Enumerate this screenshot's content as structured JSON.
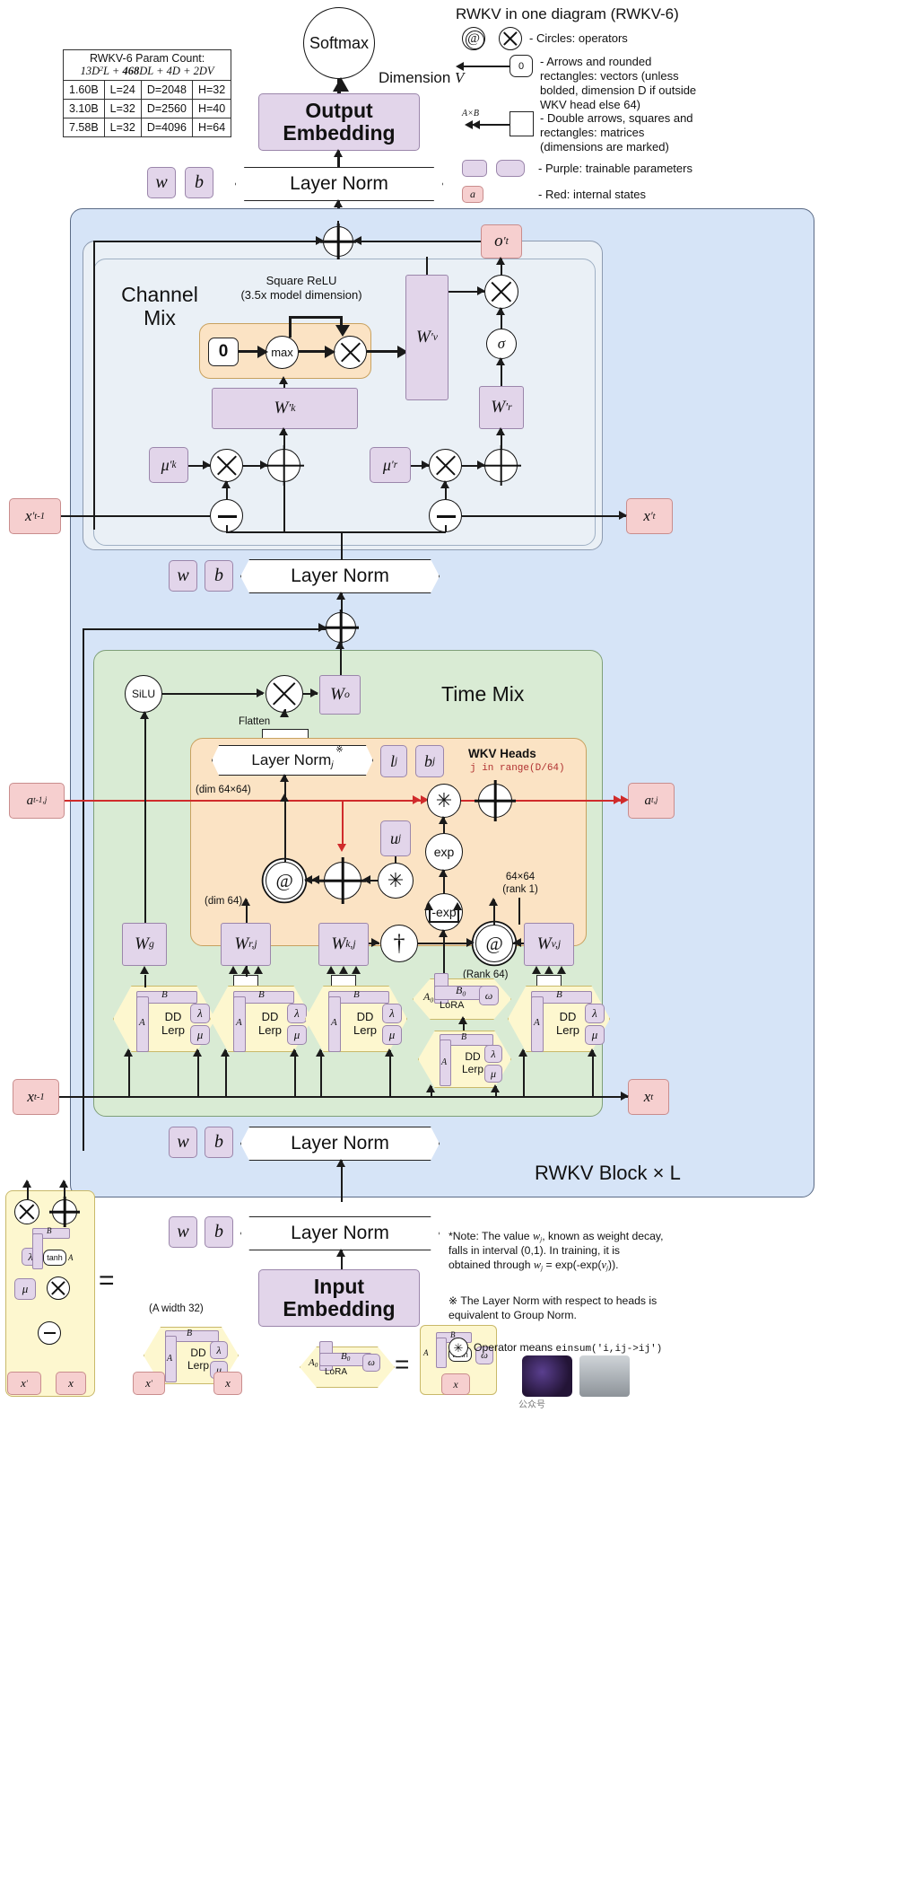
{
  "title": "RWKV in one diagram (RWKV-6)",
  "param_table": {
    "header_line1": "RWKV-6 Param Count:",
    "header_line2": "13D²L + 468DL + 4D + 2DV",
    "rows": [
      [
        "1.60B",
        "L=24",
        "D=2048",
        "H=32"
      ],
      [
        "3.10B",
        "L=32",
        "D=2560",
        "H=40"
      ],
      [
        "7.58B",
        "L=32",
        "D=4096",
        "H=64"
      ]
    ]
  },
  "legend": {
    "circles": "- Circles: operators",
    "zero_box": "0",
    "vectors": "- Arrows and rounded rectangles: vectors (unless bolded, dimension D if outside WKV head else 64)",
    "matrix_dim": "A×B",
    "matrices": "- Double arrows, squares and rectangles: matrices (dimensions are marked)",
    "purple": "- Purple: trainable parameters",
    "red_token": "a",
    "red": "- Red: internal states"
  },
  "top": {
    "softmax": "Softmax",
    "dimension": "Dimension V",
    "output_embedding": "Output Embedding",
    "layer_norm": "Layer Norm",
    "w": "w",
    "b": "b"
  },
  "channel_mix": {
    "title_line1": "Channel",
    "title_line2": "Mix",
    "square_relu_1": "Square ReLU",
    "square_relu_2": "(3.5x model dimension)",
    "zero": "0",
    "max": "max",
    "Wk": "W′k",
    "Wv": "W′v",
    "Wr": "W′r",
    "mu_k": "μ′k",
    "mu_r": "μ′r",
    "sigma": "σ",
    "x_prev": "x′t-1",
    "x_cur": "x′t",
    "o_cur": "o′t"
  },
  "time_mix": {
    "title": "Time Mix",
    "silu": "SiLU",
    "Wo": "Wo",
    "flatten": "Flatten",
    "layer_norm_j": "Layer Normj",
    "l_j": "lj",
    "b_j": "bj",
    "u_j": "uj",
    "wkv_heads": "WKV Heads",
    "wkv_range": "j in range(D/64)",
    "dim_64x64": "(dim 64×64)",
    "dim_64": "(dim 64)",
    "rank1_line1": "64×64",
    "rank1_line2": "(rank 1)",
    "rank64": "(Rank 64)",
    "exp": "exp",
    "negexp": "-exp",
    "Wg": "Wg",
    "Wrj": "Wr,j",
    "Wkj": "Wk,j",
    "Wvj": "Wv,j",
    "a_prev": "at-1,j",
    "a_cur": "at,j",
    "x_prev": "xt-1",
    "x_cur": "xt",
    "dd_lerp_1": "DD",
    "dd_lerp_2": "Lerp",
    "lora_A0": "A₀",
    "lora_B0": "B₀",
    "lora_label": "LoRA",
    "omega": "ω",
    "lam": "λ",
    "mu": "μ",
    "A": "A",
    "B": "B"
  },
  "bottom": {
    "block_label": "RWKV Block × L",
    "layer_norm": "Layer Norm",
    "input_embedding": "Input Embedding",
    "w": "w",
    "b": "b"
  },
  "notes": {
    "note1": "*Note: The value wj, known as weight decay, falls in interval (0,1). In training, it is obtained through wj = exp(-exp(vj)).",
    "note2": "※ The Layer Norm with respect to heads is equivalent to Group Norm.",
    "note3_pre": "Operator means ",
    "note3_code": "einsum('i,ij->ij')",
    "dd_caption": "(A width 32)"
  },
  "colors": {
    "purple": "#e2d5ea",
    "red": "#f6cfcf",
    "block_blue": "#d6e4f7",
    "block_green": "#d9ebd4",
    "block_orange": "#fbe3c4",
    "hex_yellow": "#fdf7cf",
    "state_red_line": "#d02b2b"
  }
}
